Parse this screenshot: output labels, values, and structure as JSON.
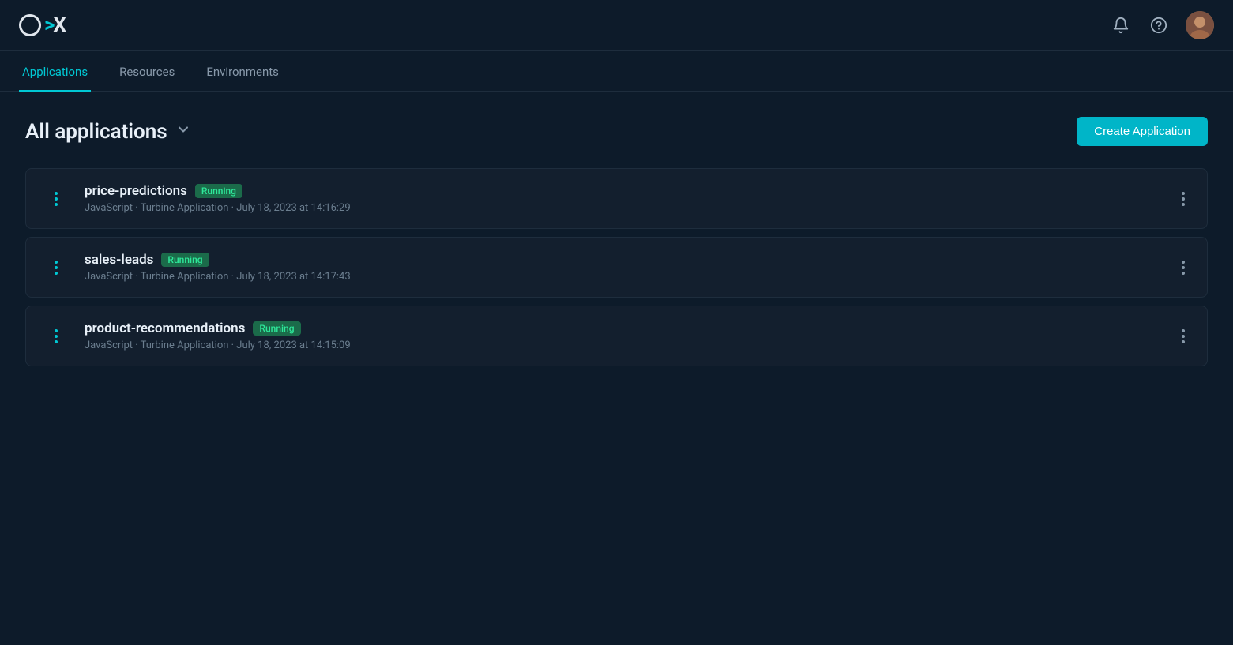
{
  "topbar": {
    "logo_text": "OX"
  },
  "nav": {
    "tabs": [
      {
        "id": "applications",
        "label": "Applications",
        "active": true
      },
      {
        "id": "resources",
        "label": "Resources",
        "active": false
      },
      {
        "id": "environments",
        "label": "Environments",
        "active": false
      }
    ]
  },
  "main": {
    "page_title": "All applications",
    "create_button_label": "Create Application",
    "applications": [
      {
        "id": "price-predictions",
        "name": "price-predictions",
        "status": "Running",
        "meta": "JavaScript · Turbine Application · July 18, 2023 at 14:16:29"
      },
      {
        "id": "sales-leads",
        "name": "sales-leads",
        "status": "Running",
        "meta": "JavaScript · Turbine Application · July 18, 2023 at 14:17:43"
      },
      {
        "id": "product-recommendations",
        "name": "product-recommendations",
        "status": "Running",
        "meta": "JavaScript · Turbine Application · July 18, 2023 at 14:15:09"
      }
    ]
  }
}
